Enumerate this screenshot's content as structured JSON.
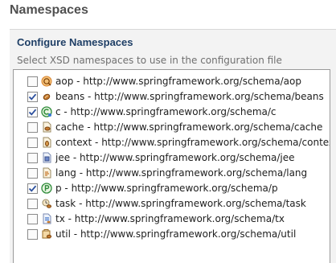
{
  "header": {
    "title": "Namespaces"
  },
  "section": {
    "title": "Configure Namespaces",
    "description": "Select XSD namespaces to use in the configuration file"
  },
  "namespaces": [
    {
      "label": "aop - http://www.springframework.org/schema/aop",
      "checked": false,
      "icon": "aop-icon"
    },
    {
      "label": "beans - http://www.springframework.org/schema/beans",
      "checked": true,
      "icon": "bean-icon"
    },
    {
      "label": "c - http://www.springframework.org/schema/c",
      "checked": true,
      "icon": "c-namespace-icon"
    },
    {
      "label": "cache - http://www.springframework.org/schema/cache",
      "checked": false,
      "icon": "cache-icon"
    },
    {
      "label": "context - http://www.springframework.org/schema/context",
      "checked": false,
      "icon": "context-icon"
    },
    {
      "label": "jee - http://www.springframework.org/schema/jee",
      "checked": false,
      "icon": "jee-icon"
    },
    {
      "label": "lang - http://www.springframework.org/schema/lang",
      "checked": false,
      "icon": "lang-icon"
    },
    {
      "label": "p - http://www.springframework.org/schema/p",
      "checked": true,
      "icon": "p-namespace-icon"
    },
    {
      "label": "task - http://www.springframework.org/schema/task",
      "checked": false,
      "icon": "task-icon"
    },
    {
      "label": "tx - http://www.springframework.org/schema/tx",
      "checked": false,
      "icon": "tx-icon"
    },
    {
      "label": "util - http://www.springframework.org/schema/util",
      "checked": false,
      "icon": "util-icon"
    }
  ],
  "colors": {
    "section_title": "#1f3f66",
    "checkmark": "#2b4f9e",
    "c_icon": "#2e8b3a",
    "p_icon": "#2e8b3a",
    "aop_icon": "#d9822b",
    "bean_icon": "#b5651d"
  }
}
